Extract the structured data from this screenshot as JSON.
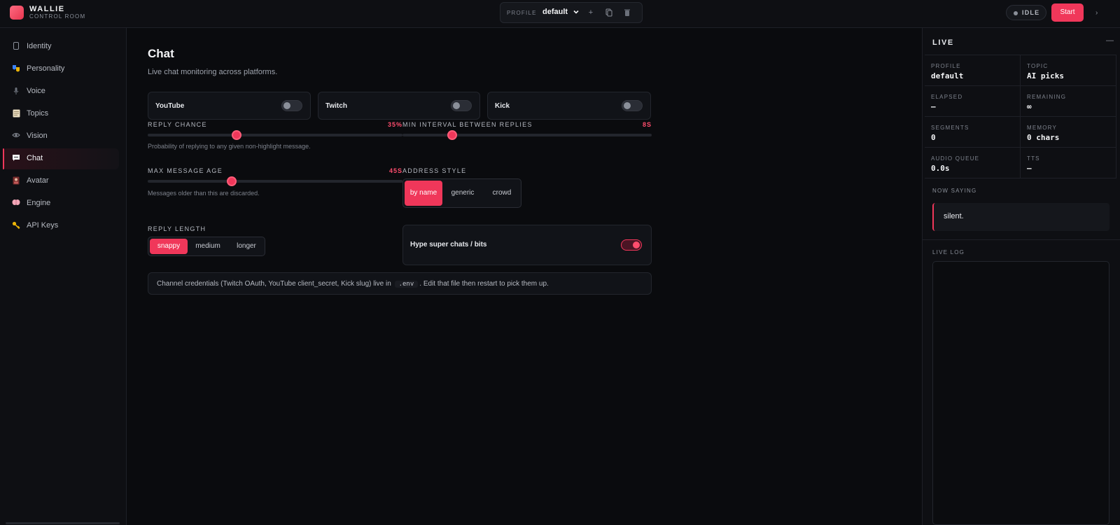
{
  "app": {
    "title": "WALLIE",
    "subtitle": "CONTROL ROOM"
  },
  "profile_bar": {
    "label": "PROFILE",
    "selected": "default"
  },
  "status": {
    "state": "IDLE",
    "start_label": "Start"
  },
  "sidebar": {
    "items": [
      {
        "label": "Identity",
        "icon": "id-card-icon"
      },
      {
        "label": "Personality",
        "icon": "theater-masks-icon"
      },
      {
        "label": "Voice",
        "icon": "microphone-icon"
      },
      {
        "label": "Topics",
        "icon": "notepad-icon"
      },
      {
        "label": "Vision",
        "icon": "eye-icon"
      },
      {
        "label": "Chat",
        "icon": "speech-bubble-icon",
        "active": true
      },
      {
        "label": "Avatar",
        "icon": "portrait-icon"
      },
      {
        "label": "Engine",
        "icon": "brain-icon"
      },
      {
        "label": "API Keys",
        "icon": "key-icon"
      }
    ]
  },
  "main": {
    "title": "Chat",
    "subtitle": "Live chat monitoring across platforms.",
    "platforms": [
      {
        "name": "YouTube",
        "enabled": false
      },
      {
        "name": "Twitch",
        "enabled": false
      },
      {
        "name": "Kick",
        "enabled": false
      }
    ],
    "reply_chance": {
      "label": "REPLY CHANCE",
      "value": "35%",
      "fraction": 0.35,
      "hint": "Probability of replying to any given non-highlight message."
    },
    "min_interval": {
      "label": "MIN INTERVAL BETWEEN REPLIES",
      "value": "8S",
      "fraction": 0.2
    },
    "max_age": {
      "label": "MAX MESSAGE AGE",
      "value": "45S",
      "fraction": 0.33,
      "hint": "Messages older than this are discarded."
    },
    "address_style": {
      "label": "ADDRESS STYLE",
      "options": [
        "by name",
        "generic",
        "crowd"
      ],
      "selected": "by name"
    },
    "reply_length": {
      "label": "REPLY LENGTH",
      "options": [
        "snappy",
        "medium",
        "longer"
      ],
      "selected": "snappy"
    },
    "hype": {
      "label": "Hype super chats / bits",
      "enabled": true
    },
    "note": {
      "before": "Channel credentials (Twitch OAuth, YouTube client_secret, Kick slug) live in",
      "code": ".env",
      "after": ". Edit that file then restart to pick them up."
    }
  },
  "live_panel": {
    "title": "LIVE",
    "stats": [
      {
        "key": "PROFILE",
        "value": "default"
      },
      {
        "key": "TOPIC",
        "value": "AI picks"
      },
      {
        "key": "ELAPSED",
        "value": "—"
      },
      {
        "key": "REMAINING",
        "value": "∞"
      },
      {
        "key": "SEGMENTS",
        "value": "0"
      },
      {
        "key": "MEMORY",
        "value": "0 chars"
      },
      {
        "key": "AUDIO QUEUE",
        "value": "0.0s"
      },
      {
        "key": "TTS",
        "value": "—"
      }
    ],
    "now_saying_label": "NOW SAYING",
    "now_saying": "silent.",
    "log_label": "LIVE LOG"
  }
}
